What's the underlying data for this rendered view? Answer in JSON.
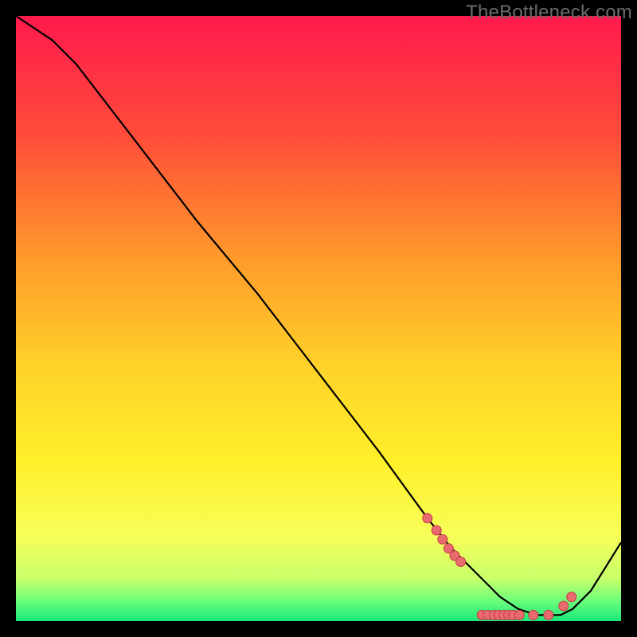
{
  "watermark": "TheBottleneck.com",
  "chart_data": {
    "type": "line",
    "title": "",
    "xlabel": "",
    "ylabel": "",
    "xlim": [
      0,
      100
    ],
    "ylim": [
      0,
      100
    ],
    "series": [
      {
        "name": "curve",
        "x": [
          0,
          6,
          10,
          20,
          30,
          40,
          50,
          60,
          68,
          72,
          75,
          78,
          80,
          83,
          86,
          90,
          92,
          95,
          100
        ],
        "y": [
          100,
          96,
          92,
          79,
          66,
          54,
          41,
          28,
          17,
          12,
          9,
          6,
          4,
          2,
          1,
          1,
          2,
          5,
          13
        ]
      }
    ],
    "markers": {
      "name": "red-dots",
      "x": [
        68,
        69.5,
        70.5,
        71.5,
        72.5,
        73.5,
        77,
        78,
        79,
        79.8,
        80.6,
        81.4,
        82.2,
        83.2,
        85.5,
        88,
        90.5,
        91.8
      ],
      "y": [
        17,
        15,
        13.5,
        12,
        10.8,
        9.8,
        1,
        1,
        1,
        1,
        1,
        1,
        1,
        1,
        1,
        1,
        2.5,
        4
      ]
    },
    "gradient_stops": [
      {
        "offset": 0.0,
        "color": "#ff1a4d"
      },
      {
        "offset": 0.2,
        "color": "#ff4d3a"
      },
      {
        "offset": 0.4,
        "color": "#ff9a2a"
      },
      {
        "offset": 0.58,
        "color": "#ffd22a"
      },
      {
        "offset": 0.74,
        "color": "#fff02a"
      },
      {
        "offset": 0.86,
        "color": "#f6ff5a"
      },
      {
        "offset": 0.93,
        "color": "#c8ff6a"
      },
      {
        "offset": 0.965,
        "color": "#6fff7a"
      },
      {
        "offset": 1.0,
        "color": "#19e87a"
      }
    ]
  }
}
